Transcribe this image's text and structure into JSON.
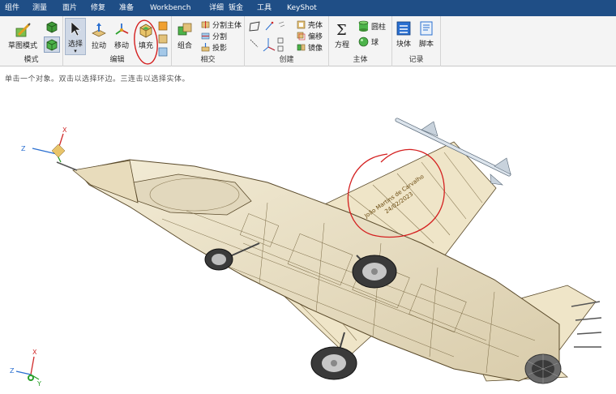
{
  "menu": {
    "tabs": [
      "组件",
      "测量",
      "面片",
      "修复",
      "准备",
      "Workbench",
      "详细",
      "钣金",
      "工具",
      "KeyShot"
    ]
  },
  "ribbon": {
    "groups": {
      "mode": "模式",
      "edit": "编辑",
      "intersect": "相交",
      "create": "创建",
      "body": "主体",
      "record": "记录"
    },
    "buttons": {
      "sketch_mode": "草图模式",
      "select": "选择",
      "pull": "拉动",
      "move": "移动",
      "fill": "填充",
      "combine": "组合",
      "split_body": "分割主体",
      "split": "分割",
      "project": "投影",
      "shell": "壳体",
      "offset": "偏移",
      "mirror": "镜像",
      "equation": "方程",
      "cylinder": "圆柱",
      "sphere": "球",
      "block": "块体",
      "script": "脚本"
    }
  },
  "status": {
    "hint": "单击一个对象。双击以选择环边。三连击以选择实体。"
  },
  "viewport": {
    "signature_name": "João Martins de Carvalho",
    "signature_date": "24/02/2023",
    "triad_labels": {
      "x": "X",
      "y": "Y",
      "z": "Z"
    }
  },
  "colors": {
    "menubar": "#1f4e86",
    "model_body": "#efe5c8",
    "model_edges": "#5a4a2a",
    "annotation": "#d42020"
  }
}
